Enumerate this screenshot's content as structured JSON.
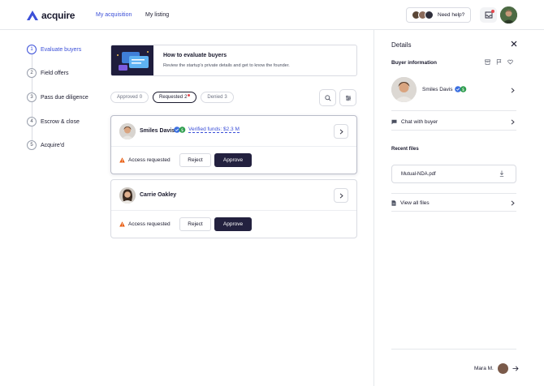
{
  "header": {
    "brand": "acquire",
    "nav": {
      "active": "My acquisition",
      "listing": "My listing"
    },
    "help_label": "Need help?",
    "accent": "#3b4fd8"
  },
  "steps": [
    {
      "num": "1",
      "label": "Evaluate buyers",
      "active": true
    },
    {
      "num": "2",
      "label": "Field offers",
      "active": false
    },
    {
      "num": "3",
      "label": "Pass due diligence",
      "active": false
    },
    {
      "num": "4",
      "label": "Escrow & close",
      "active": false
    },
    {
      "num": "5",
      "label": "Acquire'd",
      "active": false
    }
  ],
  "banner": {
    "title": "How to evaluate buyers",
    "subtitle": "Review the startup's private details and get to know the founder."
  },
  "tabs": [
    {
      "label": "Approved",
      "count": "0",
      "active": false
    },
    {
      "label": "Requested",
      "count": "2",
      "active": true
    },
    {
      "label": "Denied",
      "count": "3",
      "active": false
    }
  ],
  "buyers": [
    {
      "name": "Smiles Davis",
      "verified_funds": "Verified funds: $2.3 M",
      "status": "Access requested",
      "reject": "Reject",
      "approve": "Approve"
    },
    {
      "name": "Carrie Oakley",
      "status": "Access requested",
      "reject": "Reject",
      "approve": "Approve"
    }
  ],
  "panel": {
    "title": "Details",
    "buyer_info_title": "Buyer information",
    "buyer_name": "Smiles Davis",
    "chat": "Chat with buyer",
    "recent_files_title": "Recent files",
    "file": "Mutual-NDA.pdf",
    "view_all": "View all files",
    "owner": "Mara M."
  },
  "icons": [
    "logo-icon",
    "inbox-icon",
    "search-icon",
    "filter-icon",
    "chevron-right-icon",
    "warning-icon",
    "close-icon",
    "archive-icon",
    "flag-icon",
    "heart-icon",
    "chat-icon",
    "download-icon",
    "file-icon",
    "arrow-right-icon",
    "verified-badge-icon"
  ],
  "colors": {
    "dark": "#23213f",
    "accent": "#3b4fd8",
    "warning": "#e8590c"
  }
}
